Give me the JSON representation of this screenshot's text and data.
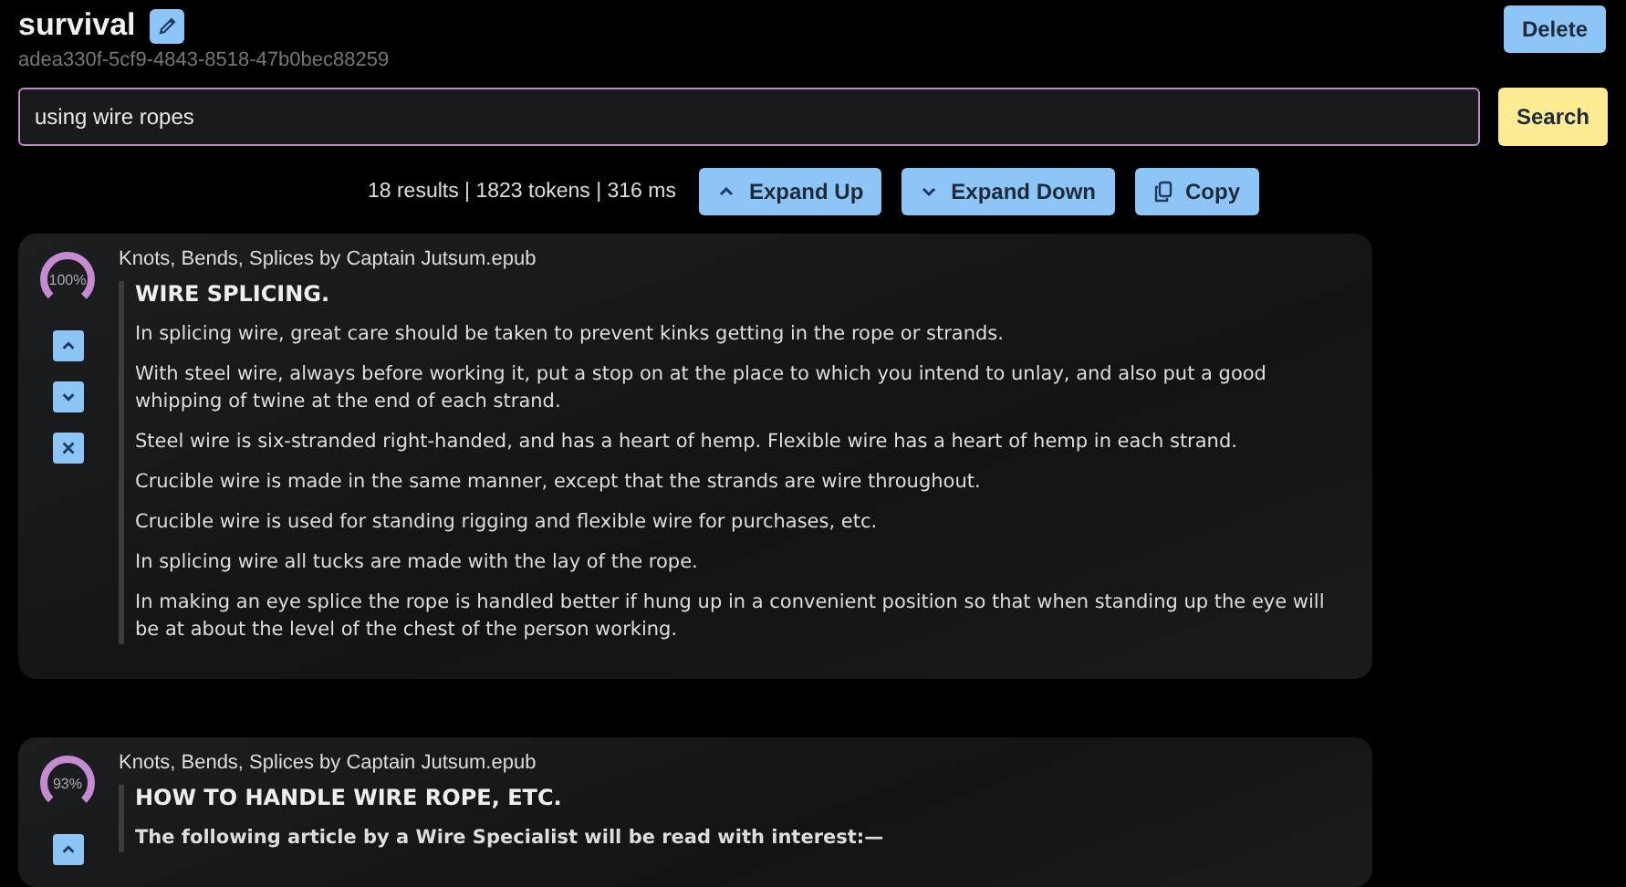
{
  "header": {
    "title": "survival",
    "id": "adea330f-5cf9-4843-8518-47b0bec88259",
    "delete_button": "Delete"
  },
  "search": {
    "value": "using wire ropes",
    "button": "Search"
  },
  "stats": "18 results | 1823 tokens | 316 ms",
  "actions": [
    {
      "kind": "up",
      "label": "Expand Up"
    },
    {
      "kind": "down",
      "label": "Expand Down"
    },
    {
      "kind": "copy",
      "label": "Copy"
    }
  ],
  "results": [
    {
      "score": "100%",
      "source": "Knots, Bends, Splices by Captain Jutsum.epub",
      "controls": [
        {
          "kind": "up"
        },
        {
          "kind": "down"
        },
        {
          "kind": "close"
        }
      ],
      "heading": "WIRE SPLICING.",
      "paragraphs": [
        {
          "bold": false,
          "text": "In splicing wire, great care should be taken to prevent kinks getting in the rope or strands."
        },
        {
          "bold": false,
          "text": "With steel wire, always before working it, put a stop on at the place to which you intend to unlay, and also put a good whipping of twine at the end of each strand."
        },
        {
          "bold": false,
          "text": "Steel wire is six-stranded right-handed, and has a heart of hemp. Flexible wire has a heart of hemp in each strand."
        },
        {
          "bold": false,
          "text": "Crucible wire is made in the same manner, except that the strands are wire throughout."
        },
        {
          "bold": false,
          "text": "Crucible wire is used for standing rigging and flexible wire for purchases, etc."
        },
        {
          "bold": false,
          "text": "In splicing wire all tucks are made with the lay of the rope."
        },
        {
          "bold": false,
          "text": "In making an eye splice the rope is handled better if hung up in a convenient position so that when standing up the eye will be at about the level of the chest of the person working."
        }
      ]
    },
    {
      "score": "93%",
      "source": "Knots, Bends, Splices by Captain Jutsum.epub",
      "controls": [
        {
          "kind": "up"
        }
      ],
      "heading": "HOW TO HANDLE WIRE ROPE, ETC.",
      "paragraphs": [
        {
          "bold": true,
          "text": "The following article by a Wire Specialist will be read with interest:—"
        }
      ]
    }
  ]
}
